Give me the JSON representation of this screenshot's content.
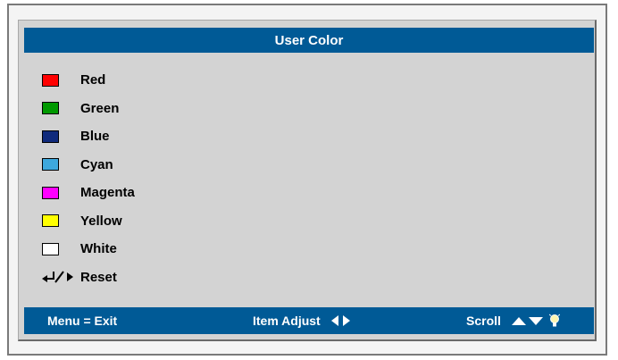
{
  "title": "User Color",
  "menu": {
    "items": [
      {
        "label": "Red",
        "swatch_color": "#ff0000"
      },
      {
        "label": "Green",
        "swatch_color": "#009900"
      },
      {
        "label": "Blue",
        "swatch_color": "#102a7c"
      },
      {
        "label": "Cyan",
        "swatch_color": "#3da8dd"
      },
      {
        "label": "Magenta",
        "swatch_color": "#ff00ff"
      },
      {
        "label": "Yellow",
        "swatch_color": "#ffff00"
      },
      {
        "label": "White",
        "swatch_color": "#ffffff"
      }
    ],
    "reset": {
      "label": "Reset",
      "icon": "enter-right-arrow-icon"
    }
  },
  "footer": {
    "exit_label": "Menu = Exit",
    "adjust_label": "Item Adjust",
    "adjust_icon": "left-right-triangle-icon",
    "scroll_label": "Scroll",
    "scroll_icon": "up-down-triangle-icon",
    "bulb_icon": "bulb-icon"
  },
  "colors": {
    "bar": "#005a96",
    "panel": "#d3d3d3",
    "text_on_bar": "#ffffff"
  }
}
